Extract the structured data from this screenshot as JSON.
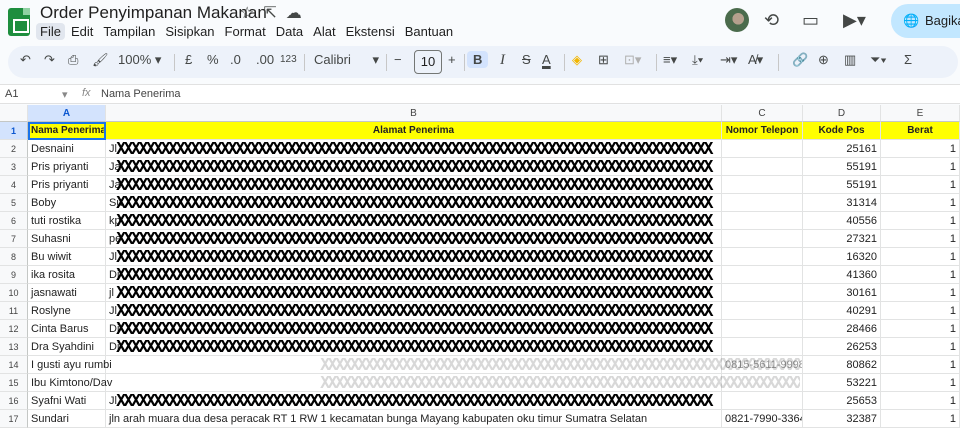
{
  "app": {
    "doc_title": "Order Penyimpanan Makanan",
    "title_icons": [
      "star-icon",
      "move-to-folder-icon",
      "cloud-status-icon"
    ],
    "menu": [
      "File",
      "Edit",
      "Tampilan",
      "Sisipkan",
      "Format",
      "Data",
      "Alat",
      "Ekstensi",
      "Bantuan"
    ],
    "share_label": "Bagikan"
  },
  "toolbar": {
    "zoom": "100%",
    "currency": "£",
    "percent": "%",
    "dec_decrease": ".0",
    "dec_increase": ".00",
    "number_format": "123",
    "font": "Calibri",
    "font_size": "10",
    "bold": "B"
  },
  "formula_bar": {
    "name_box": "A1",
    "fx": "fx",
    "content": "Nama Penerima"
  },
  "columns": [
    "A",
    "B",
    "C",
    "D",
    "E"
  ],
  "header_row": {
    "row": "1",
    "name": "Nama Penerima",
    "address": "Alamat Penerima",
    "phone": "Nomor Telepon",
    "postcode": "Kode Pos",
    "weight": "Berat"
  },
  "rows": [
    {
      "row": "2",
      "name": "Desnaini",
      "address": "Jl",
      "phone": "",
      "postcode": "25161",
      "weight": "1"
    },
    {
      "row": "3",
      "name": "Pris priyanti",
      "address": "Ja",
      "phone": "",
      "postcode": "55191",
      "weight": "1"
    },
    {
      "row": "4",
      "name": "Pris priyanti",
      "address": "Ja",
      "phone": "",
      "postcode": "55191",
      "weight": "1"
    },
    {
      "row": "5",
      "name": "Boby",
      "address": "Su",
      "phone": "",
      "postcode": "31314",
      "weight": "1"
    },
    {
      "row": "6",
      "name": "tuti rostika",
      "address": "kp",
      "phone": "",
      "postcode": "40556",
      "weight": "1"
    },
    {
      "row": "7",
      "name": "Suhasni",
      "address": "pe",
      "phone": "",
      "postcode": "27321",
      "weight": "1"
    },
    {
      "row": "8",
      "name": "Bu wiwit",
      "address": "Jl",
      "phone": "",
      "postcode": "16320",
      "weight": "1"
    },
    {
      "row": "9",
      "name": "ika rosita",
      "address": "Di",
      "phone": "",
      "postcode": "41360",
      "weight": "1"
    },
    {
      "row": "10",
      "name": "jasnawati",
      "address": "jl",
      "phone": "",
      "postcode": "30161",
      "weight": "1"
    },
    {
      "row": "11",
      "name": "Roslyne",
      "address": "Jl",
      "phone": "",
      "postcode": "40291",
      "weight": "1"
    },
    {
      "row": "12",
      "name": "Cinta Barus",
      "address": "Di",
      "phone": "",
      "postcode": "28466",
      "weight": "1"
    },
    {
      "row": "13",
      "name": "Dra Syahdini",
      "address": "Di",
      "phone": "",
      "postcode": "26253",
      "weight": "1"
    },
    {
      "row": "14",
      "name": "I gusti ayu rumbi",
      "address": "",
      "phone": "0815-5611-9998",
      "postcode": "80862",
      "weight": "1"
    },
    {
      "row": "15",
      "name": "Ibu Kimtono/Dav",
      "address": "",
      "phone": "",
      "postcode": "53221",
      "weight": "1"
    },
    {
      "row": "16",
      "name": "Syafni Wati",
      "address": "Jl",
      "phone": "",
      "postcode": "25653",
      "weight": "1"
    },
    {
      "row": "17",
      "name": "Sundari",
      "address": "jln arah muara dua desa peracak RT 1 RW 1 kecamatan bunga Mayang kabupaten oku timur Sumatra Selatan",
      "phone": "0821-7990-3364",
      "postcode": "32387",
      "weight": "1"
    }
  ],
  "redaction_text": "XXXXXXXXXXXXXXXXXXXXXXXXXXXXXXXXXXXXXXXXXXXXXXXXXXXXXXXXXXXXXXXXXXXXXXXXXXXXXXXX"
}
